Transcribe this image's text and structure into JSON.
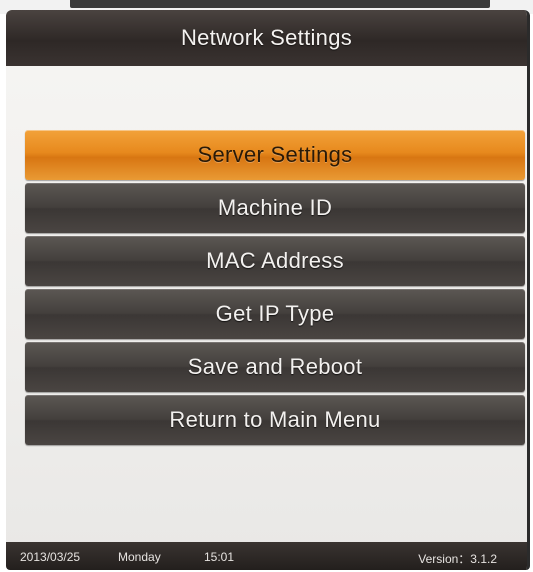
{
  "header": {
    "title": "Network Settings"
  },
  "menu": {
    "items": [
      {
        "label": "Server Settings",
        "selected": true
      },
      {
        "label": "Machine ID",
        "selected": false
      },
      {
        "label": "MAC Address",
        "selected": false
      },
      {
        "label": "Get IP Type",
        "selected": false
      },
      {
        "label": "Save and Reboot",
        "selected": false
      },
      {
        "label": "Return to Main Menu",
        "selected": false
      }
    ]
  },
  "status": {
    "date": "2013/03/25",
    "day": "Monday",
    "time": "15:01",
    "version": "Version：3.1.2"
  },
  "colors": {
    "selected_accent": "#e7891d",
    "menu_item": "#44403d",
    "title_bar": "#2e2826",
    "background": "#f1f0ee"
  }
}
